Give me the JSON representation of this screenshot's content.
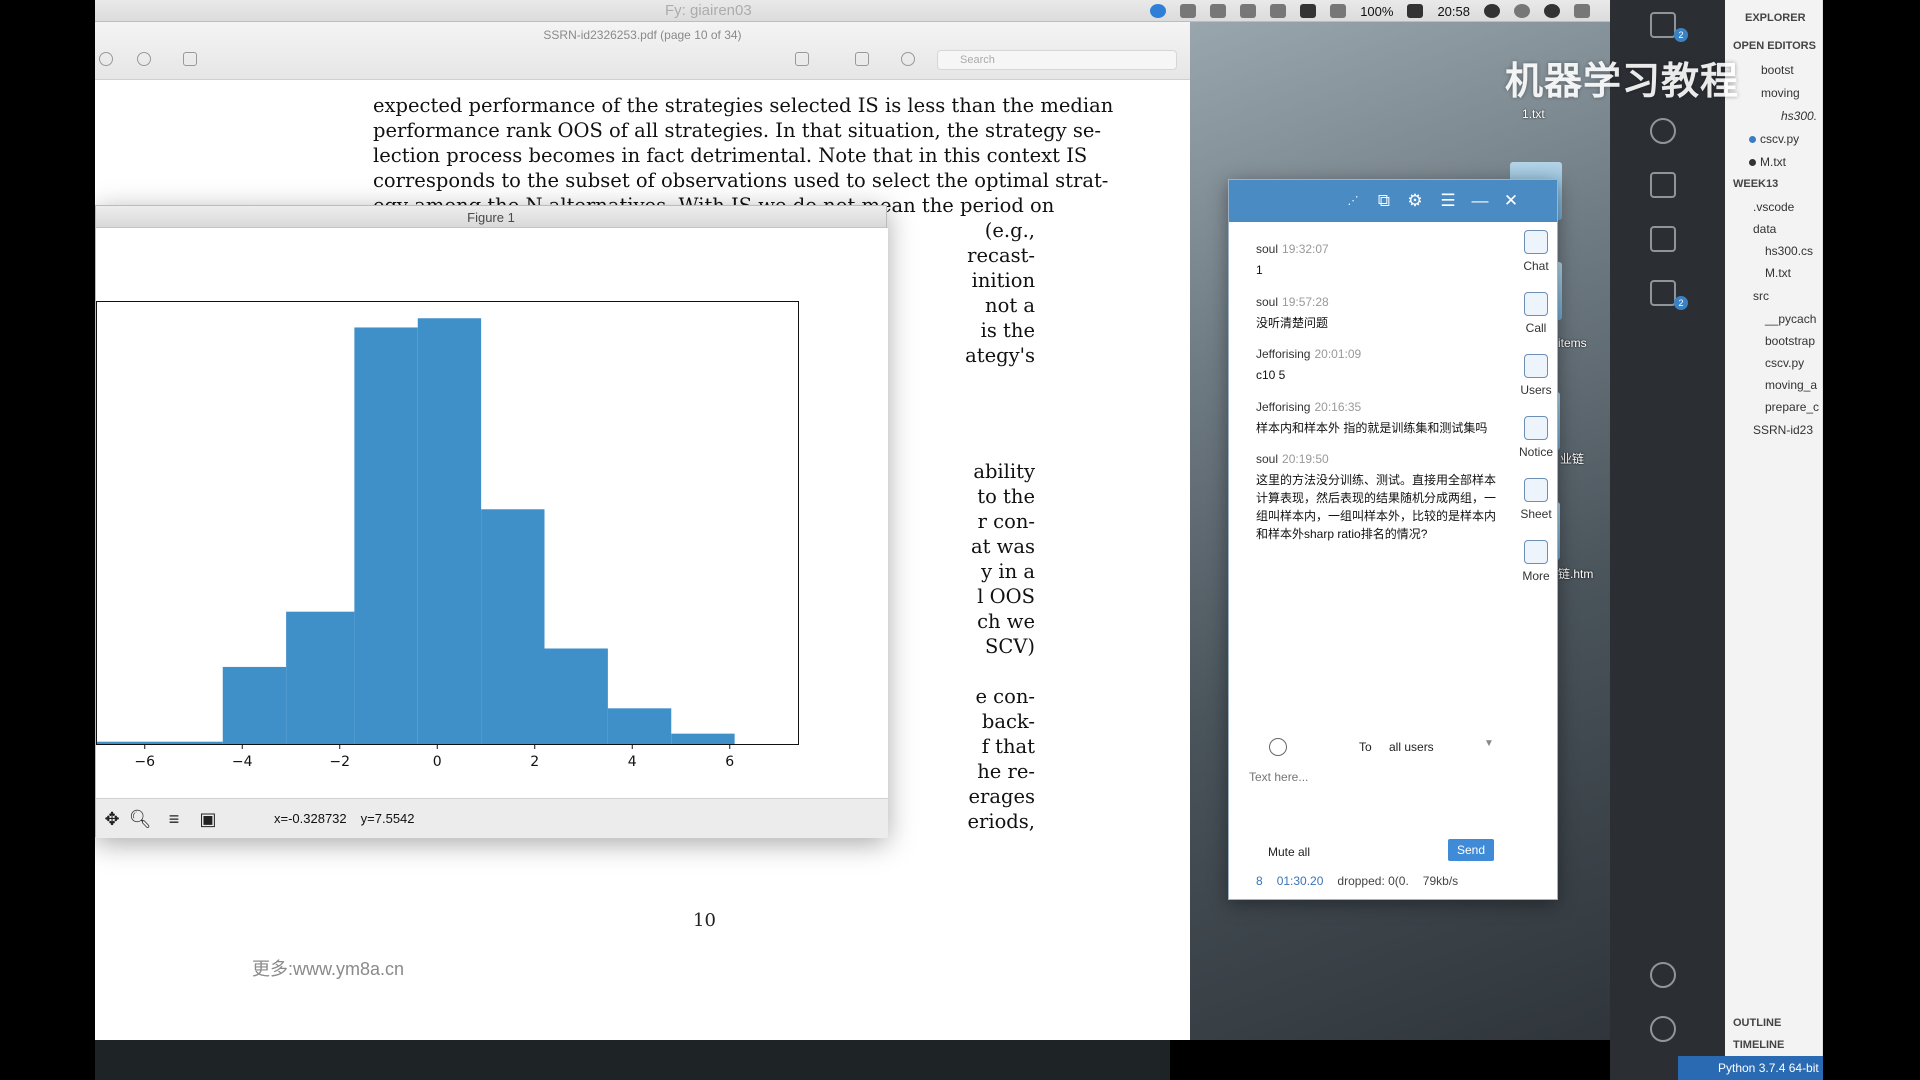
{
  "menubar": {
    "watermark": "Fy: giairen03",
    "battery": "100%",
    "time": "20:58"
  },
  "pdf": {
    "title": "SSRN-id2326253.pdf (page 10 of 34)",
    "search_placeholder": "Search",
    "lines": [
      "expected performance of the strategies selected IS is less than the median",
      "performance rank OOS of all strategies. In that situation, the strategy se-",
      "lection process becomes in fact detrimental. Note that in this context IS",
      "corresponds to the subset of observations used to select the optimal strat-",
      "egy among the N alternatives. With IS we do not mean the period on"
    ],
    "fragments": [
      "(e.g.,",
      "recast-",
      "inition",
      "not a",
      "is the",
      "ategy's",
      "ability",
      "to the",
      "r con-",
      "at was",
      "y in a",
      "l OOS",
      "ch we",
      "SCV)",
      "e con-",
      "back-",
      "f that",
      "he re-",
      "erages",
      "eriods,"
    ],
    "page_number": "10",
    "footer_watermark": "更多:www.ym8a.cn"
  },
  "figure": {
    "title": "Figure 1",
    "coords_x": "x=-0.328732",
    "coords_y": "y=7.5542"
  },
  "chart_data": {
    "type": "bar",
    "title": "",
    "xlabel": "",
    "ylabel": "",
    "bin_edges": [
      -7,
      -4.4,
      -3.1,
      -1.7,
      -0.4,
      0.9,
      2.2,
      3.5,
      4.8,
      6.1
    ],
    "values": [
      0.2,
      6.7,
      11.5,
      36.2,
      37.0,
      20.4,
      8.3,
      3.1,
      0.9
    ],
    "xlim": [
      -7.0,
      7.4
    ],
    "ylim": [
      0,
      38.5
    ],
    "xticks": [
      -6,
      -4,
      -2,
      0,
      2,
      4,
      6
    ],
    "xtick_labels": [
      "−6",
      "−4",
      "−2",
      "0",
      "2",
      "4",
      "6"
    ],
    "bar_color": "#3f8fc9",
    "grid": false,
    "legend": null
  },
  "chat": {
    "messages": [
      {
        "user": "soul",
        "time": "19:32:07",
        "text": "1"
      },
      {
        "user": "soul",
        "time": "19:57:28",
        "text": "没听清楚问题"
      },
      {
        "user": "Jefforising",
        "time": "20:01:09",
        "text": " c10 5"
      },
      {
        "user": "Jefforising",
        "time": "20:16:35",
        "text": "样本内和样本外 指的就是训练集和测试集吗"
      },
      {
        "user": "soul",
        "time": "20:19:50",
        "text": "这里的方法没分训练、测试。直接用全部样本计算表现，然后表现的结果随机分成两组，一组叫样本内，一组叫样本外，比较的是样本内和样本外sharp ratio排名的情况?"
      }
    ],
    "side": [
      "Chat",
      "Call",
      "Users",
      "Notice",
      "Sheet",
      "More"
    ],
    "to_label": "To",
    "to_value": "all users",
    "input_placeholder": "Text here...",
    "mute_all": "Mute all",
    "send": "Send",
    "status": {
      "count": "8",
      "duration": "01:30.20",
      "dropped": "dropped: 0(0.",
      "rate": "79kb/s"
    }
  },
  "desktop": {
    "labels": [
      "1.txt",
      "items",
      "业链",
      "链.htm"
    ]
  },
  "vscode": {
    "explorer_title": "EXPLORER",
    "open_editors": "OPEN EDITORS",
    "open_files": [
      "bootst",
      "moving",
      "hs300.",
      "cscv.py",
      "M.txt"
    ],
    "workspace": "WEEK13",
    "tree": [
      ".vscode",
      "data",
      "hs300.cs",
      "M.txt",
      "src",
      "__pycach",
      "bootstrap",
      "cscv.py",
      "moving_a",
      "prepare_c",
      "SSRN-id23"
    ],
    "outline": "OUTLINE",
    "timeline": "TIMELINE",
    "status": "Python 3.7.4 64-bit",
    "badge1": "2",
    "badge2": "2"
  },
  "watermark_brand": "机器学习教程"
}
